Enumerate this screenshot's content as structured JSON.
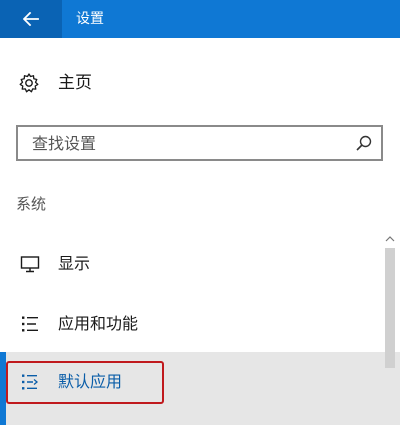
{
  "titlebar": {
    "title": "设置",
    "back_icon": "back-arrow-icon",
    "background": "#0f78d4"
  },
  "home": {
    "label": "主页",
    "icon": "gear-icon"
  },
  "search": {
    "placeholder": "查找设置",
    "value": "",
    "icon": "search-icon"
  },
  "section": {
    "label": "系统"
  },
  "nav": {
    "items": [
      {
        "label": "显示",
        "icon": "monitor-icon",
        "selected": false
      },
      {
        "label": "应用和功能",
        "icon": "list-icon",
        "selected": false
      },
      {
        "label": "默认应用",
        "icon": "default-apps-icon",
        "selected": true
      }
    ]
  },
  "colors": {
    "accent": "#0f78d4",
    "selected_background": "#e6e6e6",
    "annotation_box": "#c0191d"
  }
}
